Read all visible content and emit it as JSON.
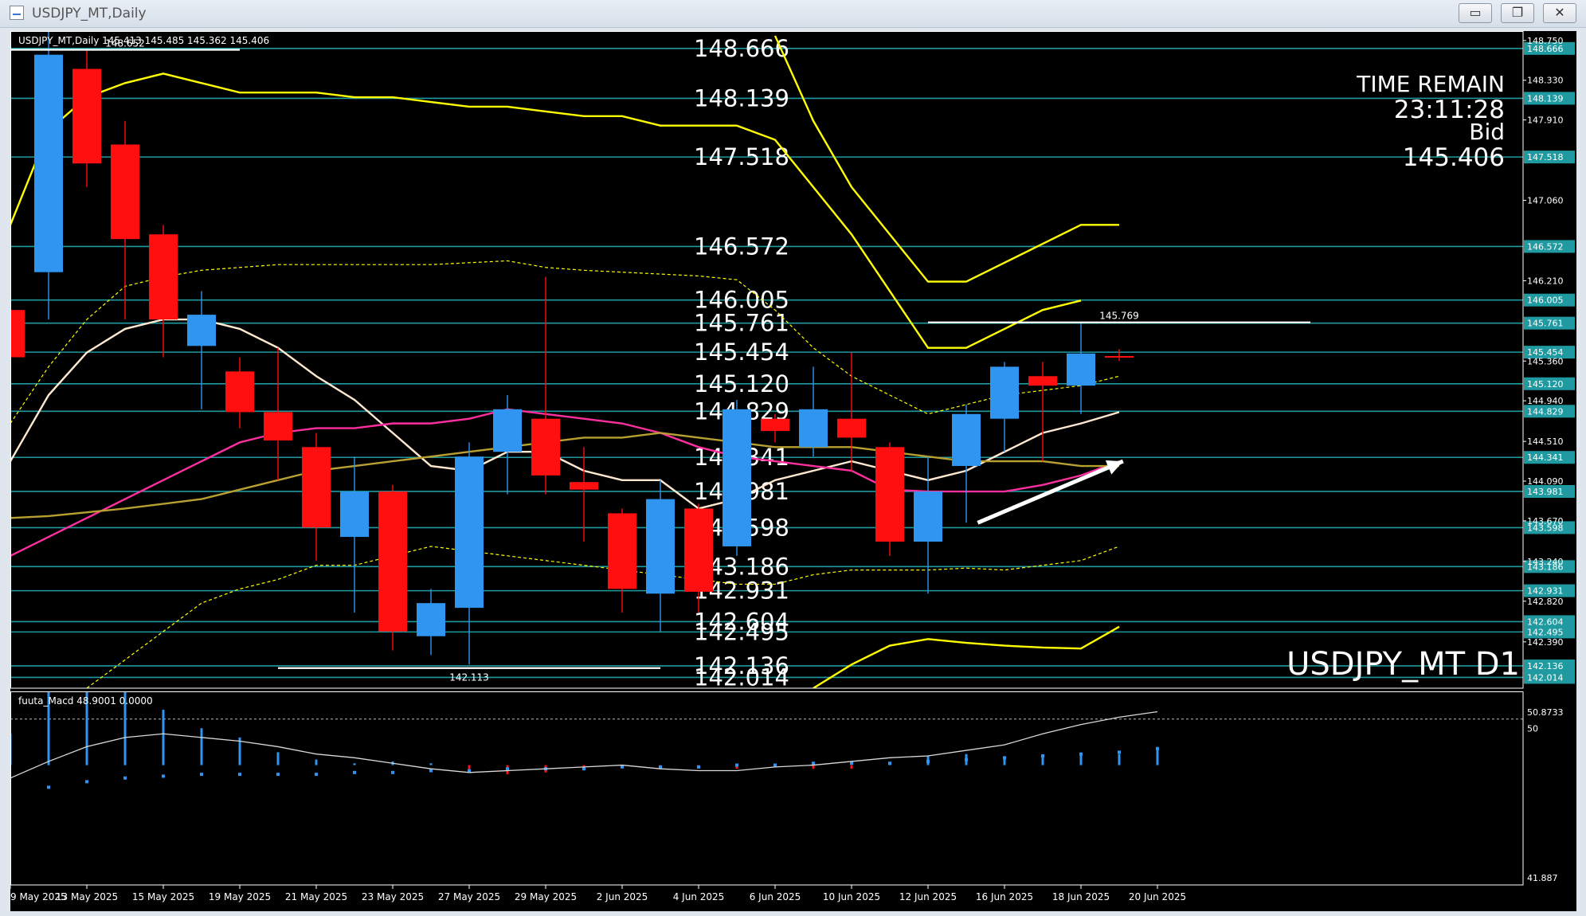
{
  "window": {
    "title": "USDJPY_MT,Daily",
    "minimize_glyph": "▭",
    "restore_glyph": "❐",
    "close_glyph": "✕"
  },
  "chart_data": {
    "type": "candlestick",
    "symbol_info": "USDJPY_MT,Daily  145.413 145.485 145.362 145.406",
    "watermark": "USDJPY_MT D1",
    "info_panel": {
      "line1": "TIME REMAIN",
      "line2": "23:11:28",
      "line3": "Bid",
      "line4": "145.406"
    },
    "ylim": [
      141.9,
      148.85
    ],
    "y_ticks": [
      148.75,
      148.33,
      147.91,
      147.06,
      146.21,
      145.36,
      144.94,
      144.51,
      144.09,
      143.67,
      143.24,
      142.82,
      142.39
    ],
    "x_labels": [
      "9 May 2025",
      "13 May 2025",
      "15 May 2025",
      "19 May 2025",
      "21 May 2025",
      "23 May 2025",
      "27 May 2025",
      "29 May 2025",
      "2 Jun 2025",
      "4 Jun 2025",
      "6 Jun 2025",
      "10 Jun 2025",
      "12 Jun 2025",
      "16 Jun 2025",
      "18 Jun 2025",
      "20 Jun 2025"
    ],
    "candles": [
      {
        "o": 145.9,
        "h": 146.5,
        "l": 144.8,
        "c": 145.4
      },
      {
        "o": 146.3,
        "h": 149.0,
        "l": 145.8,
        "c": 148.6
      },
      {
        "o": 148.45,
        "h": 148.65,
        "l": 147.2,
        "c": 147.45
      },
      {
        "o": 147.65,
        "h": 147.9,
        "l": 145.8,
        "c": 146.65
      },
      {
        "o": 146.7,
        "h": 146.8,
        "l": 145.4,
        "c": 145.8
      },
      {
        "o": 145.52,
        "h": 146.1,
        "l": 144.85,
        "c": 145.85
      },
      {
        "o": 145.25,
        "h": 145.4,
        "l": 144.65,
        "c": 144.82
      },
      {
        "o": 144.82,
        "h": 145.5,
        "l": 144.1,
        "c": 144.52
      },
      {
        "o": 144.45,
        "h": 144.6,
        "l": 143.25,
        "c": 143.6
      },
      {
        "o": 143.5,
        "h": 144.35,
        "l": 142.7,
        "c": 143.98
      },
      {
        "o": 143.98,
        "h": 144.05,
        "l": 142.3,
        "c": 142.5
      },
      {
        "o": 142.45,
        "h": 142.95,
        "l": 142.25,
        "c": 142.8
      },
      {
        "o": 142.75,
        "h": 144.5,
        "l": 142.15,
        "c": 144.35
      },
      {
        "o": 144.4,
        "h": 145.0,
        "l": 143.95,
        "c": 144.85
      },
      {
        "o": 144.75,
        "h": 146.25,
        "l": 143.95,
        "c": 144.15
      },
      {
        "o": 144.08,
        "h": 144.45,
        "l": 143.45,
        "c": 144.0
      },
      {
        "o": 143.75,
        "h": 143.8,
        "l": 142.7,
        "c": 142.95
      },
      {
        "o": 142.9,
        "h": 144.1,
        "l": 142.5,
        "c": 143.9
      },
      {
        "o": 143.8,
        "h": 143.85,
        "l": 142.7,
        "c": 142.92
      },
      {
        "o": 143.4,
        "h": 144.95,
        "l": 143.3,
        "c": 144.85
      },
      {
        "o": 144.75,
        "h": 144.8,
        "l": 144.5,
        "c": 144.62
      },
      {
        "o": 144.45,
        "h": 145.3,
        "l": 144.35,
        "c": 144.85
      },
      {
        "o": 144.75,
        "h": 145.45,
        "l": 144.2,
        "c": 144.55
      },
      {
        "o": 144.45,
        "h": 144.5,
        "l": 143.3,
        "c": 143.45
      },
      {
        "o": 143.45,
        "h": 144.35,
        "l": 142.9,
        "c": 143.98
      },
      {
        "o": 144.25,
        "h": 144.9,
        "l": 143.65,
        "c": 144.8
      },
      {
        "o": 144.75,
        "h": 145.35,
        "l": 144.4,
        "c": 145.3
      },
      {
        "o": 145.2,
        "h": 145.35,
        "l": 144.3,
        "c": 145.1
      },
      {
        "o": 145.1,
        "h": 145.77,
        "l": 144.8,
        "c": 145.44
      },
      {
        "o": 145.413,
        "h": 145.485,
        "l": 145.362,
        "c": 145.406
      }
    ],
    "hlines": [
      {
        "value": 148.666,
        "label": "148.666"
      },
      {
        "value": 148.139,
        "label": "148.139"
      },
      {
        "value": 147.518,
        "label": "147.518"
      },
      {
        "value": 146.572,
        "label": "146.572"
      },
      {
        "value": 146.005,
        "label": "146.005"
      },
      {
        "value": 145.761,
        "label": "145.761"
      },
      {
        "value": 145.454,
        "label": "145.454"
      },
      {
        "value": 145.12,
        "label": "145.120"
      },
      {
        "value": 144.829,
        "label": "144.829"
      },
      {
        "value": 144.341,
        "label": "144.341"
      },
      {
        "value": 143.981,
        "label": "143.981"
      },
      {
        "value": 143.598,
        "label": "143.598"
      },
      {
        "value": 143.186,
        "label": "143.186"
      },
      {
        "value": 142.931,
        "label": "142.931"
      },
      {
        "value": 142.604,
        "label": "142.604"
      },
      {
        "value": 142.495,
        "label": "142.495"
      },
      {
        "value": 142.136,
        "label": "142.136"
      },
      {
        "value": 142.014,
        "label": "142.014"
      }
    ],
    "marks": [
      {
        "value": 148.652,
        "label": "148.652",
        "from": 0,
        "to": 6
      },
      {
        "value": 145.769,
        "label": "145.769",
        "from": 24,
        "to": 34
      },
      {
        "value": 142.113,
        "label": "142.113",
        "from": 7,
        "to": 17
      }
    ],
    "overlays": [
      {
        "name": "upper-band",
        "style": "solid",
        "color": "#ffff00",
        "values": [
          [
            0,
            146.8
          ],
          [
            1,
            147.8
          ],
          [
            2,
            148.15
          ],
          [
            3,
            148.3
          ],
          [
            4,
            148.4
          ],
          [
            5,
            148.3
          ],
          [
            6,
            148.2
          ],
          [
            7,
            148.2
          ],
          [
            8,
            148.2
          ],
          [
            9,
            148.15
          ],
          [
            10,
            148.15
          ],
          [
            11,
            148.1
          ],
          [
            12,
            148.05
          ],
          [
            13,
            148.05
          ],
          [
            14,
            148.0
          ],
          [
            15,
            147.95
          ],
          [
            16,
            147.95
          ],
          [
            17,
            147.85
          ],
          [
            18,
            147.85
          ],
          [
            19,
            147.85
          ],
          [
            20,
            147.7
          ],
          [
            21,
            147.2
          ],
          [
            22,
            146.7
          ],
          [
            23,
            146.1
          ],
          [
            24,
            145.5
          ],
          [
            25,
            145.5
          ],
          [
            26,
            145.7
          ],
          [
            27,
            145.9
          ],
          [
            28,
            146.0
          ]
        ]
      },
      {
        "name": "lower-band",
        "style": "solid",
        "color": "#ffff00",
        "values": [
          [
            21,
            141.9
          ],
          [
            22,
            142.15
          ],
          [
            23,
            142.35
          ],
          [
            24,
            142.42
          ],
          [
            25,
            142.38
          ],
          [
            26,
            142.35
          ],
          [
            27,
            142.33
          ],
          [
            28,
            142.32
          ],
          [
            29,
            142.55
          ]
        ]
      },
      {
        "name": "outer-upper-band",
        "style": "solid",
        "color": "#ffff00",
        "values": [
          [
            20,
            148.8
          ],
          [
            21,
            147.9
          ],
          [
            22,
            147.2
          ],
          [
            23,
            146.7
          ],
          [
            24,
            146.2
          ],
          [
            25,
            146.2
          ],
          [
            26,
            146.4
          ],
          [
            27,
            146.6
          ],
          [
            28,
            146.8
          ],
          [
            29,
            146.8
          ]
        ]
      },
      {
        "name": "mid-band-upper",
        "style": "dashed",
        "color": "#ffff00",
        "values": [
          [
            0,
            144.7
          ],
          [
            1,
            145.3
          ],
          [
            2,
            145.8
          ],
          [
            3,
            146.15
          ],
          [
            4,
            146.25
          ],
          [
            5,
            146.32
          ],
          [
            6,
            146.35
          ],
          [
            7,
            146.38
          ],
          [
            8,
            146.38
          ],
          [
            9,
            146.38
          ],
          [
            10,
            146.38
          ],
          [
            11,
            146.38
          ],
          [
            12,
            146.4
          ],
          [
            13,
            146.42
          ],
          [
            14,
            146.35
          ],
          [
            15,
            146.32
          ],
          [
            16,
            146.3
          ],
          [
            17,
            146.28
          ],
          [
            18,
            146.26
          ],
          [
            19,
            146.22
          ],
          [
            20,
            145.9
          ],
          [
            21,
            145.5
          ],
          [
            22,
            145.2
          ],
          [
            23,
            145.0
          ],
          [
            24,
            144.8
          ],
          [
            25,
            144.9
          ],
          [
            26,
            145.0
          ],
          [
            27,
            145.05
          ],
          [
            28,
            145.1
          ],
          [
            29,
            145.2
          ]
        ]
      },
      {
        "name": "mid-band-lower",
        "style": "dashed",
        "color": "#ffff00",
        "values": [
          [
            2,
            141.9
          ],
          [
            3,
            142.2
          ],
          [
            4,
            142.5
          ],
          [
            5,
            142.8
          ],
          [
            6,
            142.95
          ],
          [
            7,
            143.05
          ],
          [
            8,
            143.2
          ],
          [
            9,
            143.2
          ],
          [
            10,
            143.3
          ],
          [
            11,
            143.4
          ],
          [
            12,
            143.35
          ],
          [
            13,
            143.3
          ],
          [
            14,
            143.25
          ],
          [
            15,
            143.2
          ],
          [
            16,
            143.15
          ],
          [
            17,
            143.1
          ],
          [
            18,
            143.05
          ],
          [
            19,
            143.0
          ],
          [
            20,
            143.0
          ],
          [
            21,
            143.1
          ],
          [
            22,
            143.15
          ],
          [
            23,
            143.15
          ],
          [
            24,
            143.15
          ],
          [
            25,
            143.17
          ],
          [
            26,
            143.15
          ],
          [
            27,
            143.2
          ],
          [
            28,
            143.25
          ],
          [
            29,
            143.4
          ]
        ]
      },
      {
        "name": "short-ma-white",
        "style": "solid",
        "color": "#ffe8d0",
        "values": [
          [
            0,
            144.3
          ],
          [
            1,
            145.0
          ],
          [
            2,
            145.45
          ],
          [
            3,
            145.7
          ],
          [
            4,
            145.8
          ],
          [
            5,
            145.8
          ],
          [
            6,
            145.7
          ],
          [
            7,
            145.5
          ],
          [
            8,
            145.2
          ],
          [
            9,
            144.95
          ],
          [
            10,
            144.6
          ],
          [
            11,
            144.25
          ],
          [
            12,
            144.2
          ],
          [
            13,
            144.4
          ],
          [
            14,
            144.4
          ],
          [
            15,
            144.2
          ],
          [
            16,
            144.1
          ],
          [
            17,
            144.1
          ],
          [
            18,
            143.8
          ],
          [
            19,
            143.9
          ],
          [
            20,
            144.1
          ],
          [
            21,
            144.2
          ],
          [
            22,
            144.3
          ],
          [
            23,
            144.2
          ],
          [
            24,
            144.1
          ],
          [
            25,
            144.2
          ],
          [
            26,
            144.4
          ],
          [
            27,
            144.6
          ],
          [
            28,
            144.7
          ],
          [
            29,
            144.82
          ]
        ]
      },
      {
        "name": "medium-ma-magenta",
        "style": "solid",
        "color": "#ff2fa0",
        "values": [
          [
            0,
            143.3
          ],
          [
            1,
            143.5
          ],
          [
            2,
            143.7
          ],
          [
            3,
            143.9
          ],
          [
            4,
            144.1
          ],
          [
            5,
            144.3
          ],
          [
            6,
            144.5
          ],
          [
            7,
            144.6
          ],
          [
            8,
            144.65
          ],
          [
            9,
            144.65
          ],
          [
            10,
            144.7
          ],
          [
            11,
            144.7
          ],
          [
            12,
            144.75
          ],
          [
            13,
            144.85
          ],
          [
            14,
            144.8
          ],
          [
            15,
            144.75
          ],
          [
            16,
            144.7
          ],
          [
            17,
            144.6
          ],
          [
            18,
            144.45
          ],
          [
            19,
            144.35
          ],
          [
            20,
            144.3
          ],
          [
            21,
            144.25
          ],
          [
            22,
            144.2
          ],
          [
            23,
            144.0
          ],
          [
            24,
            143.98
          ],
          [
            25,
            143.98
          ],
          [
            26,
            143.98
          ],
          [
            27,
            144.05
          ],
          [
            28,
            144.15
          ],
          [
            29,
            144.3
          ]
        ]
      },
      {
        "name": "long-ma-olive",
        "style": "solid",
        "color": "#b8a030",
        "values": [
          [
            0,
            143.7
          ],
          [
            1,
            143.72
          ],
          [
            2,
            143.76
          ],
          [
            3,
            143.8
          ],
          [
            4,
            143.85
          ],
          [
            5,
            143.9
          ],
          [
            6,
            144.0
          ],
          [
            7,
            144.1
          ],
          [
            8,
            144.2
          ],
          [
            9,
            144.25
          ],
          [
            10,
            144.3
          ],
          [
            11,
            144.35
          ],
          [
            12,
            144.4
          ],
          [
            13,
            144.45
          ],
          [
            14,
            144.5
          ],
          [
            15,
            144.55
          ],
          [
            16,
            144.55
          ],
          [
            17,
            144.6
          ],
          [
            18,
            144.55
          ],
          [
            19,
            144.5
          ],
          [
            20,
            144.45
          ],
          [
            21,
            144.45
          ],
          [
            22,
            144.45
          ],
          [
            23,
            144.4
          ],
          [
            24,
            144.35
          ],
          [
            25,
            144.3
          ],
          [
            26,
            144.3
          ],
          [
            27,
            144.3
          ],
          [
            28,
            144.25
          ],
          [
            29,
            144.25
          ]
        ]
      }
    ],
    "arrow": {
      "from": [
        25.3,
        143.65
      ],
      "to": [
        29.1,
        144.3
      ]
    },
    "macd": {
      "label": "fuuta_Macd 48.9001  0.0000",
      "ylim": [
        41.5,
        52.0
      ],
      "y_ticks": [
        50.8733,
        50,
        41.887
      ],
      "level": 50.5,
      "hist": [
        49.7,
        52.0,
        52.0,
        52.0,
        51.0,
        50.0,
        49.5,
        48.7,
        48.3,
        48.1,
        48.2,
        48.1,
        47.8,
        47.5,
        47.6,
        47.8,
        47.9,
        47.9,
        47.9,
        47.8,
        47.9,
        47.8,
        47.8,
        48.1,
        48.5,
        48.6,
        48.4,
        48.5,
        48.6,
        48.6,
        48.9
      ],
      "signal_dots": [
        46.8,
        47.1,
        47.3,
        47.4,
        47.5,
        47.5,
        47.5,
        47.5,
        47.6,
        47.6,
        47.7,
        47.7,
        47.8,
        47.8,
        47.8,
        47.9,
        47.9,
        47.9,
        48.0,
        48.0,
        48.1,
        48.1,
        48.1,
        48.2,
        48.3,
        48.4,
        48.5,
        48.6,
        48.7,
        48.9
      ],
      "line": [
        47.3,
        48.2,
        49.0,
        49.5,
        49.7,
        49.5,
        49.3,
        49.0,
        48.6,
        48.4,
        48.1,
        47.8,
        47.6,
        47.7,
        47.8,
        47.9,
        48.0,
        47.8,
        47.7,
        47.7,
        47.9,
        48.0,
        48.2,
        48.4,
        48.5,
        48.8,
        49.1,
        49.7,
        50.2,
        50.6,
        50.9
      ]
    }
  }
}
